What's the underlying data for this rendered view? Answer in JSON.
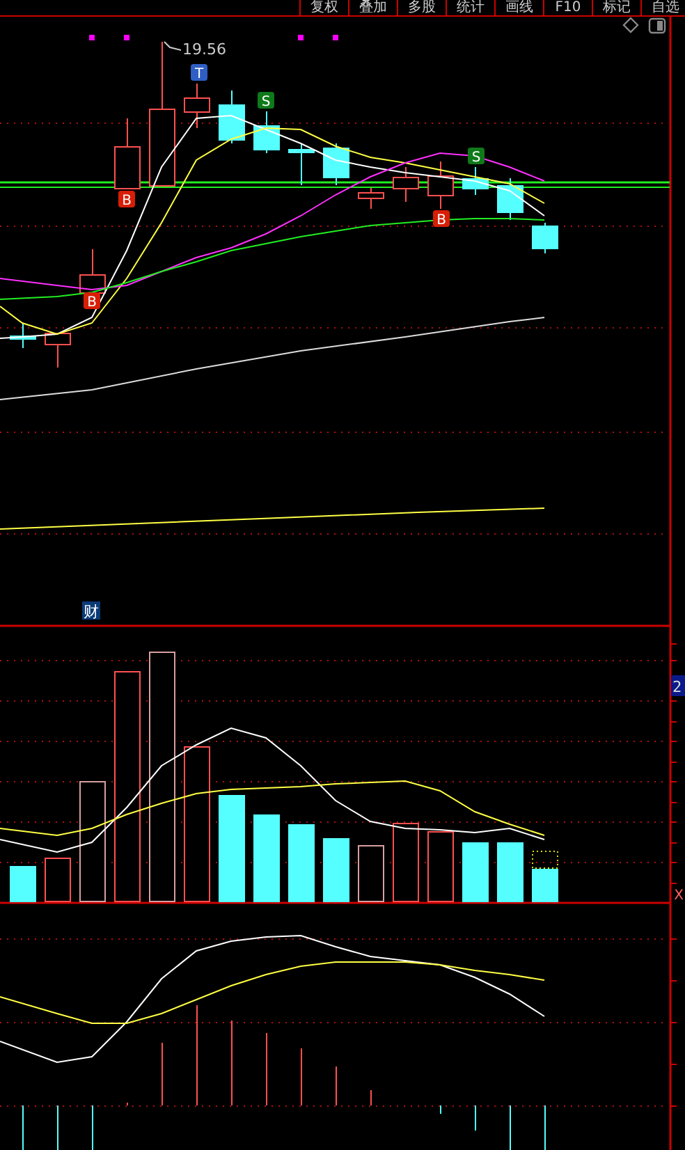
{
  "toolbar": {
    "tabs": [
      {
        "label": "复权"
      },
      {
        "label": "叠加"
      },
      {
        "label": "多股"
      },
      {
        "label": "统计"
      },
      {
        "label": "画线"
      },
      {
        "label": "F10"
      },
      {
        "label": "标记"
      },
      {
        "label": "自选"
      }
    ]
  },
  "price_panel": {
    "high_label": "19.56",
    "signals": [
      {
        "label": "B",
        "kind": "buy"
      },
      {
        "label": "B",
        "kind": "buy"
      },
      {
        "label": "T",
        "kind": "t"
      },
      {
        "label": "S",
        "kind": "sell"
      },
      {
        "label": "B",
        "kind": "buy"
      },
      {
        "label": "S",
        "kind": "sell"
      }
    ],
    "news_badge": "财"
  },
  "volume_panel": {
    "axis_label": "2",
    "close_label": "X"
  }
}
